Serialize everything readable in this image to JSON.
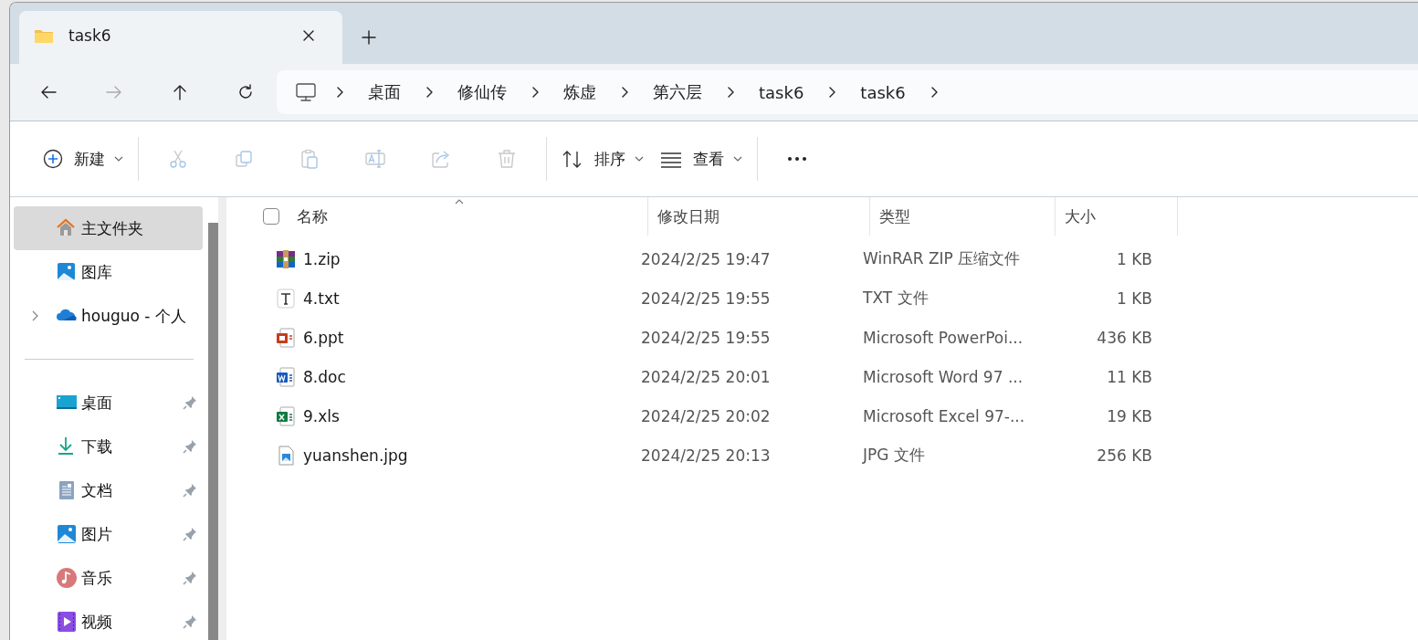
{
  "tabs": [
    {
      "title": "task6",
      "selected": true
    }
  ],
  "nav": [
    {
      "kind": "back",
      "disabled": false
    },
    {
      "kind": "forward",
      "disabled": true
    },
    {
      "kind": "up",
      "disabled": false
    },
    {
      "kind": "refresh",
      "disabled": false
    }
  ],
  "breadcrumb": [
    "桌面",
    "修仙传",
    "炼虚",
    "第六层",
    "task6",
    "task6"
  ],
  "toolbar": [
    [
      {
        "kind": "new",
        "label": "新建",
        "dropdown": true,
        "disabled": false
      }
    ],
    [
      {
        "kind": "cut",
        "disabled": true
      },
      {
        "kind": "copy",
        "disabled": true
      },
      {
        "kind": "paste",
        "disabled": true
      },
      {
        "kind": "rename",
        "disabled": true
      },
      {
        "kind": "share",
        "disabled": true
      },
      {
        "kind": "delete",
        "disabled": true
      }
    ],
    [
      {
        "kind": "sort",
        "label": "排序",
        "dropdown": true,
        "disabled": false
      },
      {
        "kind": "view",
        "label": "查看",
        "dropdown": true,
        "disabled": false
      }
    ],
    [
      {
        "kind": "more",
        "disabled": false
      }
    ]
  ],
  "sidebar": {
    "top": [
      {
        "kind": "home",
        "label": "主文件夹",
        "selected": true,
        "expandable": false
      },
      {
        "kind": "gallery",
        "label": "图库",
        "selected": false,
        "expandable": false
      },
      {
        "kind": "cloud",
        "label": "houguo - 个人",
        "selected": false,
        "expandable": true,
        "expanded": false
      }
    ],
    "pinned": [
      {
        "kind": "desktop",
        "label": "桌面",
        "selected": false,
        "pinned": true
      },
      {
        "kind": "download",
        "label": "下载",
        "selected": false,
        "pinned": true
      },
      {
        "kind": "documents",
        "label": "文档",
        "selected": false,
        "pinned": true
      },
      {
        "kind": "pictures",
        "label": "图片",
        "selected": false,
        "pinned": true
      },
      {
        "kind": "music",
        "label": "音乐",
        "selected": false,
        "pinned": true
      },
      {
        "kind": "videos",
        "label": "视频",
        "selected": false,
        "pinned": true
      }
    ]
  },
  "table": {
    "select_all_checked": false,
    "columns": [
      {
        "label": "名称",
        "sorted": true
      },
      {
        "label": "修改日期",
        "sorted": false
      },
      {
        "label": "类型",
        "sorted": false
      },
      {
        "label": "大小",
        "sorted": false
      }
    ],
    "rows": [
      {
        "kind": "zip",
        "name": "1.zip",
        "modified": "2024/2/25 19:47",
        "type": "WinRAR ZIP 压缩文件",
        "size": "1 KB",
        "selected": false
      },
      {
        "kind": "txt",
        "name": "4.txt",
        "modified": "2024/2/25 19:55",
        "type": "TXT 文件",
        "size": "1 KB",
        "selected": false
      },
      {
        "kind": "ppt",
        "name": "6.ppt",
        "modified": "2024/2/25 19:55",
        "type": "Microsoft PowerPoi...",
        "size": "436 KB",
        "selected": false
      },
      {
        "kind": "doc",
        "name": "8.doc",
        "modified": "2024/2/25 20:01",
        "type": "Microsoft Word 97 ...",
        "size": "11 KB",
        "selected": false
      },
      {
        "kind": "xls",
        "name": "9.xls",
        "modified": "2024/2/25 20:02",
        "type": "Microsoft Excel 97-...",
        "size": "19 KB",
        "selected": false
      },
      {
        "kind": "jpg",
        "name": "yuanshen.jpg",
        "modified": "2024/2/25 20:13",
        "type": "JPG 文件",
        "size": "256 KB",
        "selected": false
      }
    ]
  }
}
